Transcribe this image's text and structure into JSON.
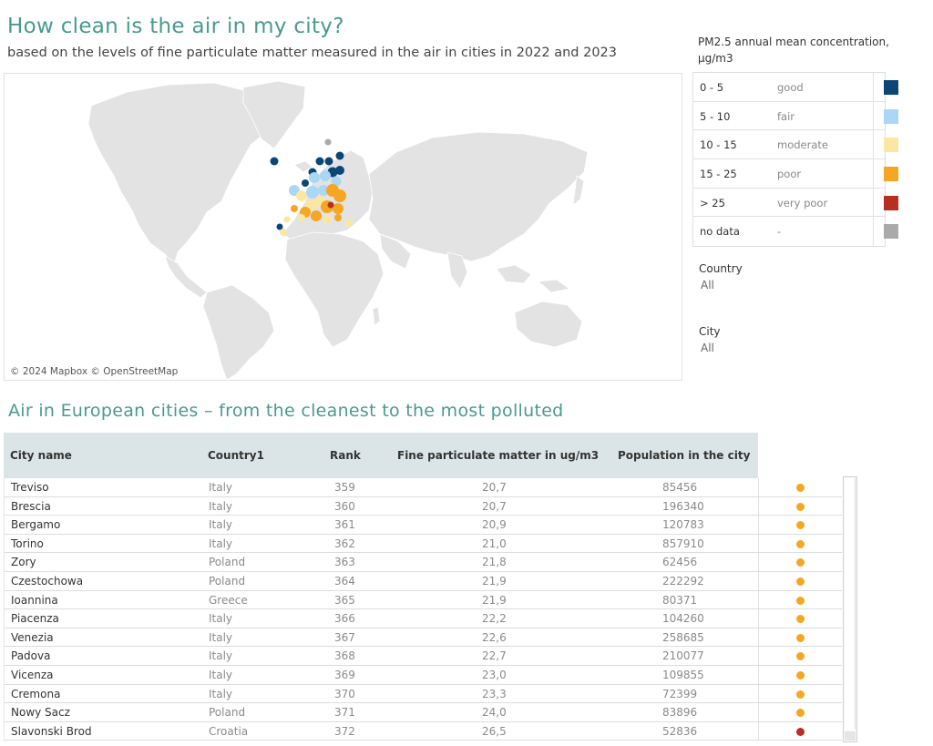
{
  "title": "How clean is the air in my city?",
  "subtitle": "based on the levels of fine particulate matter measured in the air in cities in 2022 and 2023",
  "map": {
    "credit": "© 2024 Mapbox © OpenStreetMap"
  },
  "legend": {
    "title": "PM2.5 annual mean concentration, µg/m3",
    "items": [
      {
        "range": "0 - 5",
        "label": "good",
        "color": "#0b4677"
      },
      {
        "range": "5 - 10",
        "label": "fair",
        "color": "#a9d7f5"
      },
      {
        "range": "10 - 15",
        "label": "moderate",
        "color": "#fbe7a1"
      },
      {
        "range": "15 - 25",
        "label": "poor",
        "color": "#f5a623"
      },
      {
        "range": "> 25",
        "label": "very poor",
        "color": "#b52f23"
      },
      {
        "range": "no data",
        "label": "-",
        "color": "#aaaaaa"
      }
    ]
  },
  "filters": {
    "country_label": "Country",
    "country_value": "All",
    "city_label": "City",
    "city_value": "All"
  },
  "table": {
    "title": "Air in European cities – from the cleanest to the most polluted",
    "headers": {
      "city": "City name",
      "country": "Country1",
      "rank": "Rank",
      "pm": "Fine particulate matter in ug/m3",
      "population": "Population in the city"
    },
    "rows": [
      {
        "city": "Treviso",
        "country": "Italy",
        "rank": "359",
        "pm": "20,7",
        "population": "85456",
        "color": "#f5a623"
      },
      {
        "city": "Brescia",
        "country": "Italy",
        "rank": "360",
        "pm": "20,7",
        "population": "196340",
        "color": "#f5a623"
      },
      {
        "city": "Bergamo",
        "country": "Italy",
        "rank": "361",
        "pm": "20,9",
        "population": "120783",
        "color": "#f5a623"
      },
      {
        "city": "Torino",
        "country": "Italy",
        "rank": "362",
        "pm": "21,0",
        "population": "857910",
        "color": "#f5a623"
      },
      {
        "city": "Zory",
        "country": "Poland",
        "rank": "363",
        "pm": "21,8",
        "population": "62456",
        "color": "#f5a623"
      },
      {
        "city": "Czestochowa",
        "country": "Poland",
        "rank": "364",
        "pm": "21,9",
        "population": "222292",
        "color": "#f5a623"
      },
      {
        "city": "Ioannina",
        "country": "Greece",
        "rank": "365",
        "pm": "21,9",
        "population": "80371",
        "color": "#f5a623"
      },
      {
        "city": "Piacenza",
        "country": "Italy",
        "rank": "366",
        "pm": "22,2",
        "population": "104260",
        "color": "#f5a623"
      },
      {
        "city": "Venezia",
        "country": "Italy",
        "rank": "367",
        "pm": "22,6",
        "population": "258685",
        "color": "#f5a623"
      },
      {
        "city": "Padova",
        "country": "Italy",
        "rank": "368",
        "pm": "22,7",
        "population": "210077",
        "color": "#f5a623"
      },
      {
        "city": "Vicenza",
        "country": "Italy",
        "rank": "369",
        "pm": "23,0",
        "population": "109855",
        "color": "#f5a623"
      },
      {
        "city": "Cremona",
        "country": "Italy",
        "rank": "370",
        "pm": "23,3",
        "population": "72399",
        "color": "#f5a623"
      },
      {
        "city": "Nowy Sacz",
        "country": "Poland",
        "rank": "371",
        "pm": "24,0",
        "population": "83896",
        "color": "#f5a623"
      },
      {
        "city": "Slavonski Brod",
        "country": "Croatia",
        "rank": "372",
        "pm": "26,5",
        "population": "52836",
        "color": "#b52f23"
      }
    ]
  }
}
